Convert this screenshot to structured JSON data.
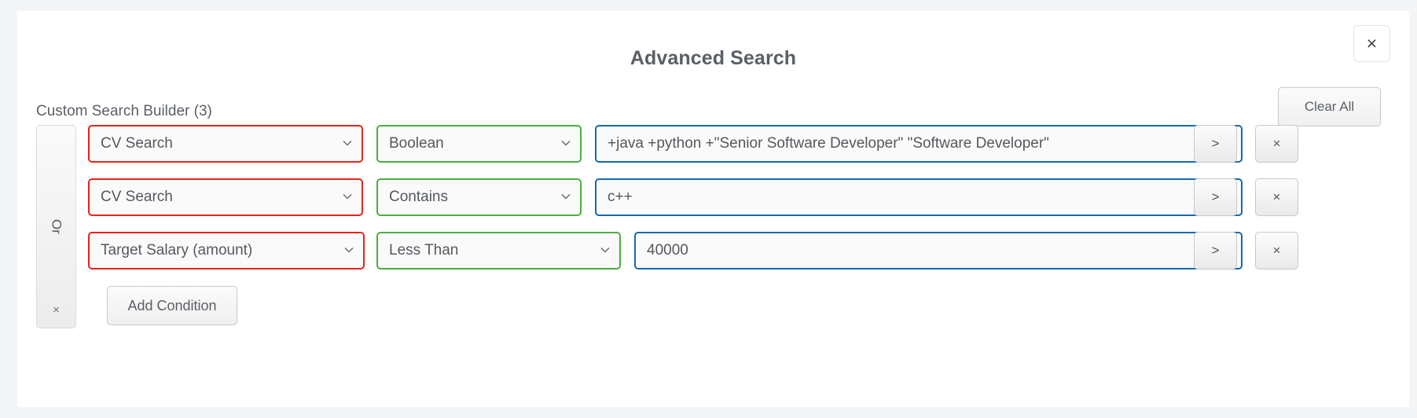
{
  "modal": {
    "title": "Advanced Search",
    "close_label": "×",
    "clear_all_label": "Clear All"
  },
  "builder": {
    "label": "Custom Search Builder (3)",
    "group_operator": "Or",
    "group_remove_label": "×",
    "add_condition_label": "Add Condition",
    "row_more_label": ">",
    "row_remove_label": "×",
    "caret_icon": "chevron-down-icon",
    "rows": [
      {
        "field": "CV Search",
        "operator": "Boolean",
        "value": "+java +python +\"Senior Software Developer\" \"Software Developer\"",
        "more_label": ">",
        "remove_label": "×"
      },
      {
        "field": "CV Search",
        "operator": "Contains",
        "value": "c++",
        "more_label": ">",
        "remove_label": "×"
      },
      {
        "field": "Target Salary (amount)",
        "operator": "Less Than",
        "value": "40000",
        "more_label": ">",
        "remove_label": "×"
      }
    ]
  },
  "colors": {
    "page_background": "#f4f5f7",
    "modal_background": "#ffffff",
    "field_border": "#e8231a",
    "operator_border": "#4cae3f",
    "value_border": "#1769ac",
    "text": "#54585e",
    "title_text": "#5a5f66"
  }
}
